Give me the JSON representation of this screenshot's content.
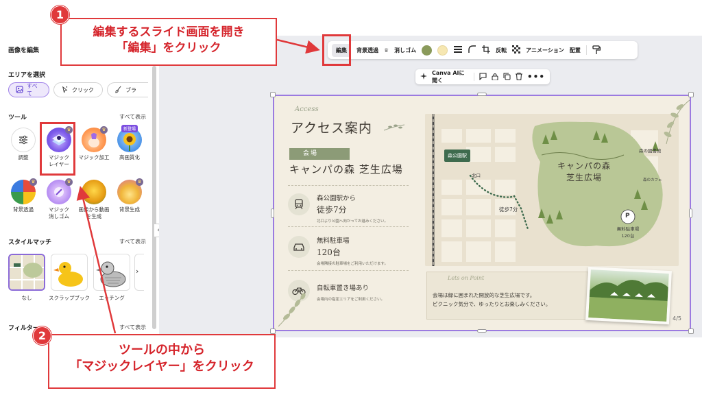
{
  "panel": {
    "title": "画像を編集",
    "area_title": "エリアを選択",
    "area_tabs": [
      "すべて",
      "クリック",
      "ブラ"
    ],
    "tools_title": "ツール",
    "show_all": "すべて表示",
    "tools": [
      {
        "label": "調整"
      },
      {
        "label": "マジック\nレイヤー"
      },
      {
        "label": "マジック加工"
      },
      {
        "label": "高画質化",
        "badge": "新登場"
      },
      {
        "label": "背景透過"
      },
      {
        "label": "マジック\n消しゴム"
      },
      {
        "label": "画像から動画\nを生成"
      },
      {
        "label": "背景生成"
      }
    ],
    "style_title": "スタイルマッチ",
    "styles": [
      "なし",
      "スクラップブック",
      "エッチング"
    ],
    "filter_title": "フィルター"
  },
  "toolbar": {
    "items": [
      "編集",
      "背景透過",
      "消しゴム",
      "反転",
      "アニメーション",
      "配置"
    ],
    "colors": [
      "#8a9a5b",
      "#f6e7b2"
    ]
  },
  "context": {
    "ai_label": "Canva AIに聞く"
  },
  "slide": {
    "access_script": "Access",
    "title": "アクセス案内",
    "venue_tag": "会場",
    "venue": "キャンパの森 芝生広場",
    "rows": [
      {
        "line1": "森公園駅から",
        "line2": "徒歩7分",
        "sub": "北口より公園へ向かってお進みください。"
      },
      {
        "line1": "無料駐車場",
        "line2": "120台",
        "sub": "会場隣接の駐車場をご利用いただけます。"
      },
      {
        "line1": "自転車置き場あり",
        "line2": "",
        "sub": "会場内の指定エリアをご利用ください。"
      }
    ],
    "map": {
      "station": "森公園駅",
      "north_exit": "北口",
      "walk": "徒歩7分",
      "park": "キャンパの森\n芝生広場",
      "library": "森の図書館",
      "cafe": "森のカフェ",
      "parking": "無料駐車場\n120台",
      "parking_icon": "P"
    },
    "note_script": "Lets on Point",
    "note_text": "会場は緑に囲まれた開放的な芝生広場です。\nピクニック気分で、ゆったりとお楽しみください。",
    "page": "4/5"
  },
  "callouts": {
    "c1_num": "1",
    "c1_text": "編集するスライド画面を開き\n「編集」をクリック",
    "c2_num": "2",
    "c2_text": "ツールの中から\n「マジックレイヤー」をクリック"
  }
}
